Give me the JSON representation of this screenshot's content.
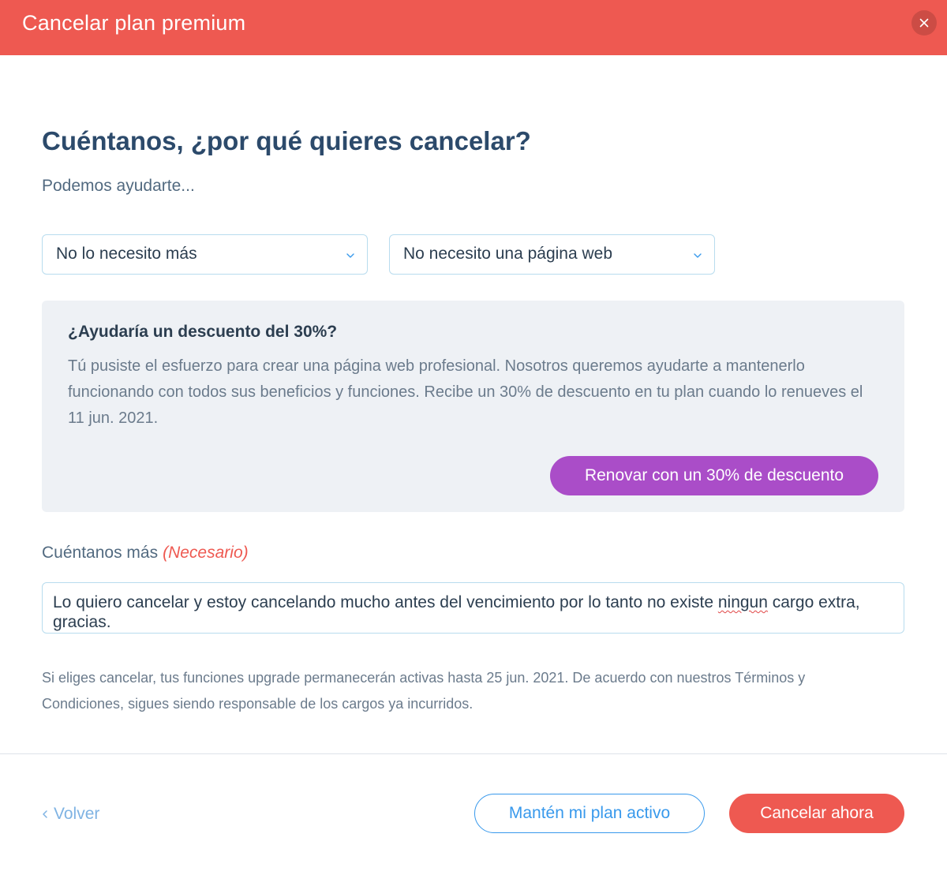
{
  "header": {
    "title": "Cancelar plan premium",
    "close_icon": "close-icon"
  },
  "main": {
    "heading": "Cuéntanos, ¿por qué quieres cancelar?",
    "subheading": "Podemos ayudarte...",
    "reason_select": {
      "value": "No lo necesito más"
    },
    "detail_select": {
      "value": "No necesito una página web"
    },
    "offer": {
      "title": "¿Ayudaría un descuento del 30%?",
      "text": "Tú pusiste el esfuerzo para crear una página web profesional. Nosotros queremos ayudarte a mantenerlo funcionando con todos sus beneficios y funciones. Recibe un 30% de descuento en tu plan cuando lo renueves el 11 jun. 2021.",
      "button_label": "Renovar con un 30% de descuento"
    },
    "more": {
      "label": "Cuéntanos más",
      "required": "(Necesario)",
      "value_before": "Lo quiero cancelar y estoy cancelando mucho antes del vencimiento por lo tanto no existe ",
      "value_misspelled": "ningun",
      "value_after": " cargo extra, gracias."
    },
    "disclaimer": "Si eliges cancelar, tus funciones upgrade permanecerán activas hasta 25 jun. 2021. De acuerdo con nuestros Términos y Condiciones, sigues siendo responsable de los cargos ya incurridos."
  },
  "footer": {
    "back_label": "Volver",
    "keep_label": "Mantén mi plan activo",
    "cancel_label": "Cancelar ahora"
  },
  "colors": {
    "header_bg": "#ee5951",
    "heading": "#2c4a6b",
    "purple_button": "#aa4dc8",
    "blue_accent": "#3899ec",
    "required_text": "#ee5951"
  }
}
